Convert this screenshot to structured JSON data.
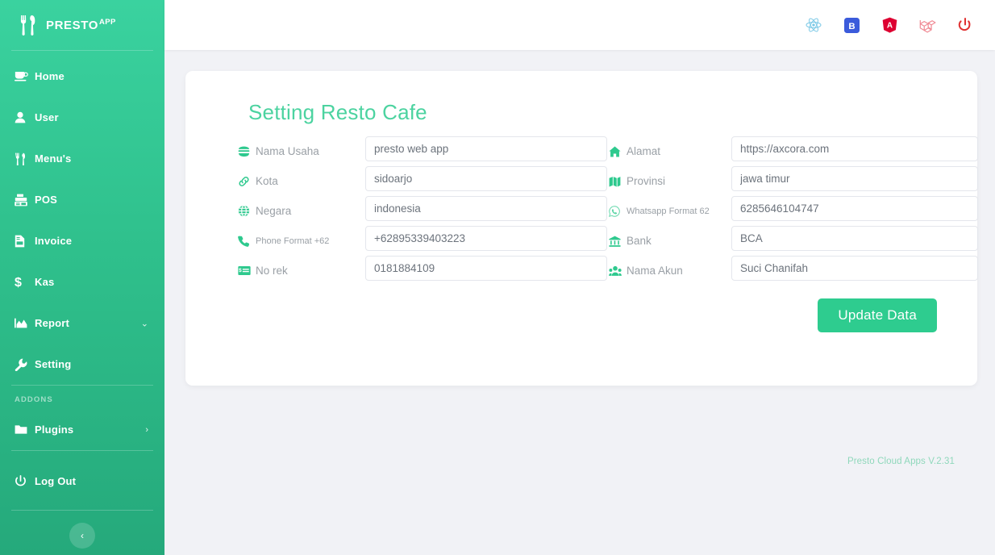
{
  "brand": {
    "name": "PRESTO",
    "suffix": "APP",
    "icon": "fork-knife-icon"
  },
  "sidebar": {
    "addons_label": "ADDONS",
    "items": [
      {
        "label": "Home",
        "icon": "coffee-cup-icon",
        "caret": ""
      },
      {
        "label": "User",
        "icon": "user-icon",
        "caret": ""
      },
      {
        "label": "Menu's",
        "icon": "utensils-icon",
        "caret": ""
      },
      {
        "label": "POS",
        "icon": "cash-register-icon",
        "caret": ""
      },
      {
        "label": "Invoice",
        "icon": "file-invoice-icon",
        "caret": ""
      },
      {
        "label": "Kas",
        "icon": "dollar-sign-icon",
        "caret": ""
      },
      {
        "label": "Report",
        "icon": "chart-area-icon",
        "caret": "⌄"
      },
      {
        "label": "Setting",
        "icon": "wrench-icon",
        "caret": ""
      }
    ],
    "addons_items": [
      {
        "label": "Plugins",
        "icon": "folder-icon",
        "caret": "›"
      }
    ],
    "logout": {
      "label": "Log Out",
      "icon": "power-icon"
    },
    "collapse": {
      "icon": "chevron-left-icon",
      "glyph": "‹"
    }
  },
  "topbar": {
    "icons": [
      {
        "name": "react-icon",
        "color": "#61dafb"
      },
      {
        "name": "bootstrap-icon",
        "color": "#563d7c"
      },
      {
        "name": "angular-icon",
        "color": "#dd0031"
      },
      {
        "name": "laravel-icon",
        "color": "#ff2d20"
      },
      {
        "name": "power-logout-icon",
        "color": "#e03131"
      }
    ]
  },
  "card": {
    "title": "Setting Resto Cafe",
    "fields": [
      {
        "label": "Nama Usaha",
        "icon": "burger-icon",
        "value": "presto web app",
        "name": "nama-usaha",
        "small": false
      },
      {
        "label": "Alamat",
        "icon": "home-icon",
        "value": "https://axcora.com",
        "name": "alamat",
        "small": false
      },
      {
        "label": "Kota",
        "icon": "link-icon",
        "value": "sidoarjo",
        "name": "kota",
        "small": false
      },
      {
        "label": "Provinsi",
        "icon": "map-icon",
        "value": "jawa timur",
        "name": "provinsi",
        "small": false
      },
      {
        "label": "Negara",
        "icon": "globe-icon",
        "value": "indonesia",
        "name": "negara",
        "small": false
      },
      {
        "label": "Whatsapp Format 62",
        "icon": "whatsapp-icon",
        "value": "6285646104747",
        "name": "whatsapp",
        "small": true
      },
      {
        "label": "Phone Format +62",
        "icon": "phone-icon",
        "value": "+62895339403223",
        "name": "phone",
        "small": true
      },
      {
        "label": "Bank",
        "icon": "bank-icon",
        "value": "BCA",
        "name": "bank",
        "small": false
      },
      {
        "label": "No rek",
        "icon": "money-check-icon",
        "value": "0181884109",
        "name": "no-rek",
        "small": false
      },
      {
        "label": "Nama Akun",
        "icon": "users-icon",
        "value": "Suci Chanifah",
        "name": "nama-akun",
        "small": false
      }
    ],
    "submit_label": "Update Data"
  },
  "footer": {
    "text": "Presto Cloud Apps V.2.31"
  },
  "colors": {
    "brand_green": "#2ecc8f",
    "sidebar_top": "#3ad29f",
    "sidebar_bottom": "#25a97b",
    "title_green": "#4cd3a0",
    "page_bg": "#f1f2f6",
    "label_gray": "#9aa0a6"
  }
}
